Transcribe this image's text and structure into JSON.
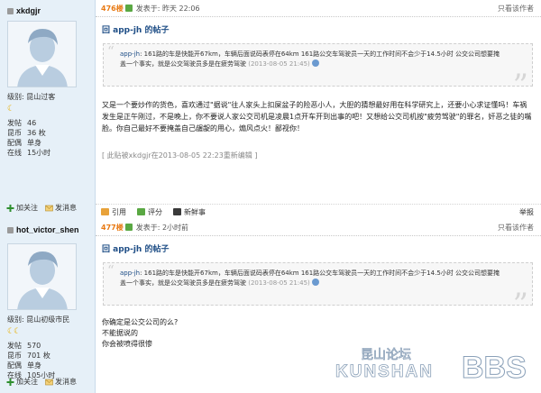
{
  "posts": [
    {
      "user": {
        "name": "xkdgjr",
        "level": "级别: 昆山过客",
        "stars": "☾",
        "stats": [
          {
            "k": "发帖",
            "v": "46"
          },
          {
            "k": "昆币",
            "v": "36 枚"
          },
          {
            "k": "配偶",
            "v": "单身"
          },
          {
            "k": "在线",
            "v": "15小时"
          }
        ],
        "follow_label": "加关注",
        "message_label": "发消息"
      },
      "floor": "476楼",
      "posted": "发表于: 昨天 22:06",
      "only_author": "只看该作者",
      "reply_title": "回 app-jh 的帖子",
      "quote": {
        "author": "app-jh",
        "text": ": 161路的车是快能开67km，车辆后面说码表停在64km 161路公交车驾驶员一天的工作时间不会少于14.5小时 公交公司想要掩盖一个事实，就是公交驾驶员多是在疲劳驾驶",
        "time": "(2013-08-05 21:45)"
      },
      "body": "又是一个要炒作的货色，喜欢通过\"据说\"往人家头上扣屎盆子的险恶小人，大胆的猜想最好用在科学研究上，还要小心求证懂吗！车祸发生是正午刚过，不是晚上，你不要说人家公交司机是凌晨1点开车开到出事的吧！又想给公交司机按\"疲劳驾驶\"的罪名，奸恶之徒的嘴脸。你自己最好不要掩盖自己龌龊的用心，煽风点火！鄙视你！",
      "edit_note": "[ 此贴被xkdgjr在2013-08-05 22:23重新编辑 ]",
      "footer": {
        "quote_label": "引用",
        "rate_label": "评分",
        "hot_label": "新鲜事",
        "report_label": "举报"
      }
    },
    {
      "user": {
        "name": "hot_victor_shen",
        "level": "级别: 昆山初级市民",
        "stars": "☾☾",
        "stats": [
          {
            "k": "发帖",
            "v": "570"
          },
          {
            "k": "昆币",
            "v": "701 枚"
          },
          {
            "k": "配偶",
            "v": "单身"
          },
          {
            "k": "在线",
            "v": "105小时"
          }
        ],
        "follow_label": "加关注",
        "message_label": "发消息"
      },
      "floor": "477楼",
      "posted": "发表于: 2小时前",
      "only_author": "只看该作者",
      "reply_title": "回 app-jh 的帖子",
      "quote": {
        "author": "app-jh",
        "text": ": 161路的车是快能开67km，车辆后面说码表停在64km 161路公交车驾驶员一天的工作时间不会少于14.5小时 公交公司想要掩盖一个事实，就是公交驾驶员多是在疲劳驾驶",
        "time": "(2013-08-05 21:45)"
      },
      "body_lines": [
        "你确定是公交公司的么?",
        "不能据说的",
        "你会被喷得很惨"
      ]
    }
  ],
  "watermark": {
    "cn": "昆山论坛",
    "en": "KUNSHAN",
    "bbs": "BBS"
  }
}
